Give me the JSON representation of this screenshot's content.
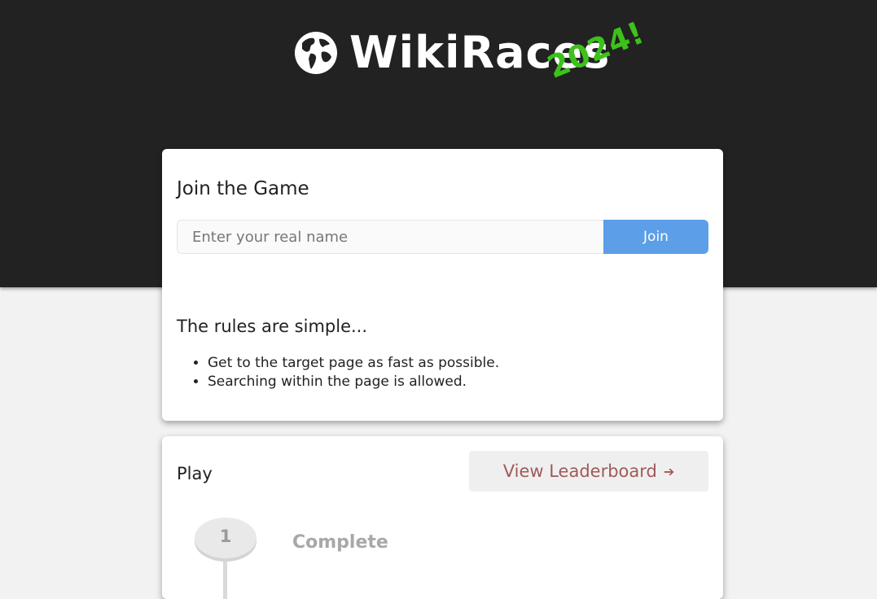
{
  "header": {
    "brand": "WikiRaces",
    "year": "2024!",
    "logo_icon": "globe-icon"
  },
  "join": {
    "title": "Join the Game",
    "name_placeholder": "Enter your real name",
    "name_value": "",
    "join_label": "Join"
  },
  "rules": {
    "title": "The rules are simple...",
    "items": [
      "Get to the target page as fast as possible.",
      "Searching within the page is allowed."
    ]
  },
  "play": {
    "title": "Play",
    "leaderboard_label": "View Leaderboard",
    "leaderboard_icon": "arrow-right-icon",
    "steps": [
      {
        "number": "1",
        "status": "Complete"
      }
    ]
  },
  "colors": {
    "header_bg": "#222222",
    "year_accent": "#3cc21a",
    "join_button": "#5c9ee8",
    "leaderboard_text": "#a05a5a"
  }
}
